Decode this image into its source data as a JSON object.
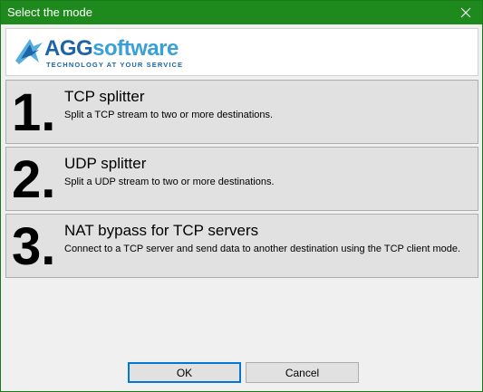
{
  "window": {
    "title": "Select the mode"
  },
  "logo": {
    "brand_a": "AGG",
    "brand_b": "software",
    "tagline": "TECHNOLOGY AT YOUR SERVICE"
  },
  "options": [
    {
      "number": "1.",
      "title": "TCP splitter",
      "description": "Split a TCP stream to two or more destinations."
    },
    {
      "number": "2.",
      "title": "UDP splitter",
      "description": "Split a UDP stream to two or more destinations."
    },
    {
      "number": "3.",
      "title": "NAT bypass for TCP servers",
      "description": "Connect to a TCP server and send data to another destination using the TCP client mode."
    }
  ],
  "buttons": {
    "ok": "OK",
    "cancel": "Cancel"
  },
  "colors": {
    "titlebar": "#1e8a1e",
    "brand_dark": "#1d64a8",
    "brand_light": "#3aa0d8",
    "focus": "#0078d7"
  }
}
